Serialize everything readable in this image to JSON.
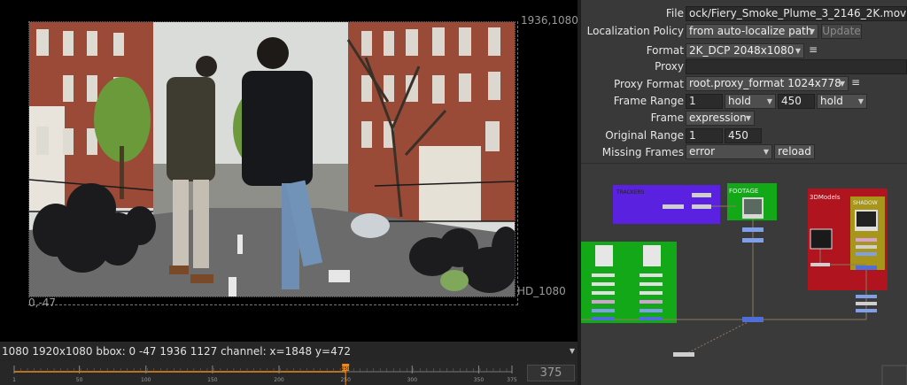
{
  "viewer": {
    "top_right_label": "1936,1080",
    "bottom_left_label": "0,-47",
    "format_label": "HD_1080"
  },
  "info_bar": {
    "text": "1080 1920x1080  bbox: 0 -47 1936 1127 channel: x=1848 y=472"
  },
  "timeline": {
    "ticks": [
      "1",
      "50",
      "100",
      "150",
      "200",
      "250",
      "300",
      "350",
      "375"
    ],
    "tick_values": [
      1,
      50,
      100,
      150,
      200,
      250,
      300,
      350,
      375
    ],
    "range": [
      1,
      375
    ],
    "current_frame": 250,
    "current_frame_label": "250",
    "end_frame": "375"
  },
  "properties": {
    "file_label": "File",
    "file_value": "ock/Fiery_Smoke_Plume_3_2146_2K.mov",
    "localization_label": "Localization Policy",
    "localization_value": "from auto-localize path",
    "update_button": "Update",
    "format_label": "Format",
    "format_value": "2K_DCP 2048x1080",
    "proxy_label": "Proxy",
    "proxy_value": "",
    "proxy_format_label": "Proxy Format",
    "proxy_format_value": "root.proxy_format 1024x778",
    "frame_range_label": "Frame Range",
    "frame_range_start": "1",
    "frame_range_before": "hold",
    "frame_range_end": "450",
    "frame_range_after": "hold",
    "frame_label": "Frame",
    "frame_mode": "expression",
    "original_range_label": "Original Range",
    "original_range_start": "1",
    "original_range_end": "450",
    "missing_frames_label": "Missing Frames",
    "missing_frames_value": "error",
    "reload_button": "reload"
  },
  "graph": {
    "backdrops": [
      {
        "label": "TRACKERS",
        "color": "#5a22e0"
      },
      {
        "label": "FOOTAGE",
        "color": "#13a817"
      },
      {
        "label": "3DModels",
        "color": "#b0141e"
      },
      {
        "label": "SHADOW",
        "color": "#a8961a"
      },
      {
        "label": "",
        "color": "#13a817"
      }
    ]
  },
  "colors": {
    "viewer_bg": "#000000",
    "panel_bg": "#393939",
    "playhead": "#f08a1a",
    "node_blue": "#4f6fd6"
  }
}
